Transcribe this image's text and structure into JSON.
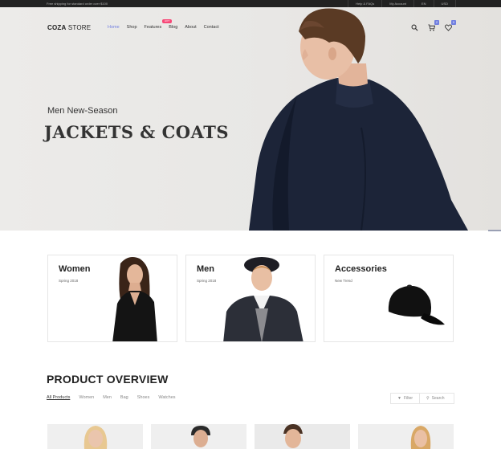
{
  "topbar": {
    "notice": "Free shipping for standard order over $100",
    "links": [
      "Help & FAQs",
      "My Account",
      "EN",
      "USD"
    ]
  },
  "header": {
    "logo_bold": "COZA",
    "logo_light": " STORE",
    "nav": [
      "Home",
      "Shop",
      "Features",
      "Blog",
      "About",
      "Contact"
    ],
    "active_nav": "Home",
    "hot_badge": "HOT",
    "cart_count": "2",
    "wishlist_count": "0",
    "icons": [
      "search-icon",
      "cart-icon",
      "heart-icon"
    ]
  },
  "hero": {
    "subtitle": "Men New-Season",
    "title": "JACKETS & COATS"
  },
  "banners": [
    {
      "title": "Women",
      "subtitle": "Spring 2018"
    },
    {
      "title": "Men",
      "subtitle": "Spring 2018"
    },
    {
      "title": "Accessories",
      "subtitle": "New Trend"
    }
  ],
  "overview": {
    "title": "PRODUCT OVERVIEW",
    "filters": [
      "All Products",
      "Women",
      "Men",
      "Bag",
      "Shoes",
      "Watches"
    ],
    "active_filter": "All Products",
    "filter_button": "Filter",
    "search_button": "Search"
  },
  "colors": {
    "accent": "#717fe0",
    "badge": "#f74877",
    "topbar": "#222222"
  }
}
